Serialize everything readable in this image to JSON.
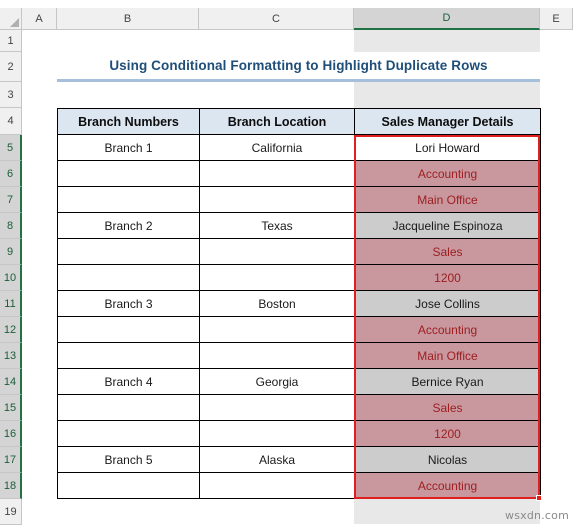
{
  "app": {
    "watermark": "wsxdn.com"
  },
  "grid": {
    "column_headers": [
      "A",
      "B",
      "C",
      "D",
      "E"
    ],
    "selected_column": "D",
    "row_headers": [
      "1",
      "2",
      "3",
      "4",
      "5",
      "6",
      "7",
      "8",
      "9",
      "10",
      "11",
      "12",
      "13",
      "14",
      "15",
      "16",
      "17",
      "18",
      "19"
    ],
    "selected_rows": [
      "5",
      "6",
      "7",
      "8",
      "9",
      "10",
      "11",
      "12",
      "13",
      "14",
      "15",
      "16",
      "17",
      "18"
    ],
    "selection_range": "D5:D18",
    "active_cell": "D5"
  },
  "title": {
    "text": "Using Conditional Formatting to Highlight Duplicate Rows",
    "color": "#1f4e79",
    "underline_color": "#a5bfdd"
  },
  "table": {
    "headers": [
      "Branch Numbers",
      "Branch Location",
      "Sales Manager Details"
    ],
    "header_bg": "#dce6f1",
    "rows": [
      {
        "row": "5",
        "branch": "Branch 1",
        "location": "California",
        "details": "Lori Howard",
        "state": "active"
      },
      {
        "row": "6",
        "branch": "",
        "location": "",
        "details": "Accounting",
        "state": "duplicate"
      },
      {
        "row": "7",
        "branch": "",
        "location": "",
        "details": "Main Office",
        "state": "duplicate"
      },
      {
        "row": "8",
        "branch": "Branch 2",
        "location": "Texas",
        "details": "Jacqueline Espinoza",
        "state": "selected"
      },
      {
        "row": "9",
        "branch": "",
        "location": "",
        "details": "Sales",
        "state": "duplicate"
      },
      {
        "row": "10",
        "branch": "",
        "location": "",
        "details": "1200",
        "state": "duplicate"
      },
      {
        "row": "11",
        "branch": "Branch 3",
        "location": "Boston",
        "details": "Jose Collins",
        "state": "selected"
      },
      {
        "row": "12",
        "branch": "",
        "location": "",
        "details": "Accounting",
        "state": "duplicate"
      },
      {
        "row": "13",
        "branch": "",
        "location": "",
        "details": "Main Office",
        "state": "duplicate"
      },
      {
        "row": "14",
        "branch": "Branch 4",
        "location": "Georgia",
        "details": "Bernice Ryan",
        "state": "selected"
      },
      {
        "row": "15",
        "branch": "",
        "location": "",
        "details": "Sales",
        "state": "duplicate"
      },
      {
        "row": "16",
        "branch": "",
        "location": "",
        "details": "1200",
        "state": "duplicate"
      },
      {
        "row": "17",
        "branch": "Branch 5",
        "location": "Alaska",
        "details": "Nicolas",
        "state": "selected"
      },
      {
        "row": "18",
        "branch": "",
        "location": "",
        "details": "Accounting",
        "state": "duplicate"
      }
    ],
    "duplicate_fill": "#c9989e",
    "duplicate_text": "#9c1f22",
    "selected_fill": "#cccccc",
    "selection_border": "#e02020"
  }
}
